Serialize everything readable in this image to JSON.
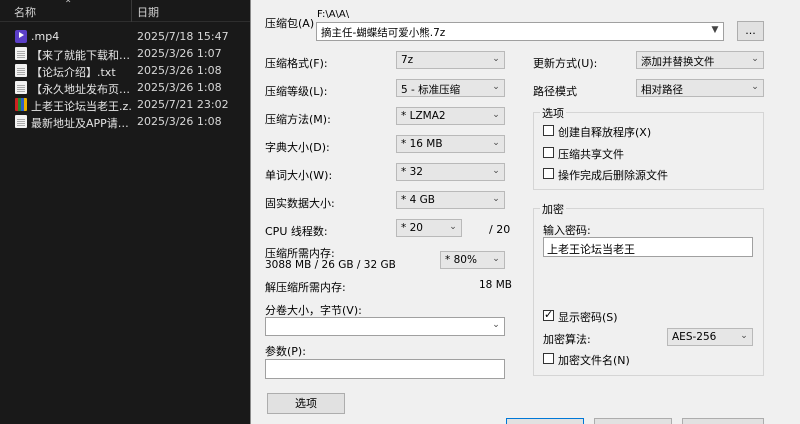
{
  "explorer": {
    "col_name": "名称",
    "col_date": "日期",
    "files": [
      {
        "name": ".mp4",
        "date": "2025/7/18 15:47",
        "icon": "video-file-icon"
      },
      {
        "name": "【来了就能下载和…",
        "date": "2025/3/26 1:07",
        "icon": "text-file-icon"
      },
      {
        "name": "【论坛介绍】.txt",
        "date": "2025/3/26 1:08",
        "icon": "text-file-icon"
      },
      {
        "name": "【永久地址发布页…",
        "date": "2025/3/26 1:08",
        "icon": "text-file-icon"
      },
      {
        "name": "上老王论坛当老王.z…",
        "date": "2025/7/21 23:02",
        "icon": "archive-file-icon"
      },
      {
        "name": "最新地址及APP请…",
        "date": "2025/3/26 1:08",
        "icon": "text-file-icon"
      }
    ]
  },
  "dialog": {
    "archive_label": "压缩包(A)",
    "archive_path": "F:\\A\\A\\",
    "archive_name": "摘主任-蝴蝶结可爱小熊.7z",
    "browse_label": "...",
    "format_label": "压缩格式(F):",
    "format_value": "7z",
    "level_label": "压缩等级(L):",
    "level_value": "5 - 标准压缩",
    "method_label": "压缩方法(M):",
    "method_value": "* LZMA2",
    "dict_label": "字典大小(D):",
    "dict_value": "* 16 MB",
    "word_label": "单词大小(W):",
    "word_value": "* 32",
    "solid_label": "固实数据大小:",
    "solid_value": "* 4 GB",
    "cpu_label": "CPU 线程数:",
    "cpu_value": "* 20",
    "cpu_max": "/ 20",
    "mem_label": "压缩所需内存:",
    "mem_detail": "3088 MB / 26 GB / 32 GB",
    "mem_value": "* 80%",
    "demem_label": "解压缩所需内存:",
    "demem_value": "18 MB",
    "split_label": "分卷大小，字节(V):",
    "split_value": "",
    "params_label": "参数(P):",
    "params_value": "",
    "options_button": "选项",
    "update_label": "更新方式(U):",
    "update_value": "添加并替换文件",
    "path_label": "路径模式",
    "path_value": "相对路径",
    "options_group": "选项",
    "sfx_label": "创建自释放程序(X)",
    "sfx_checked": false,
    "shared_label": "压缩共享文件",
    "shared_checked": false,
    "delete_label": "操作完成后删除源文件",
    "delete_checked": false,
    "encrypt_group": "加密",
    "password_label": "输入密码:",
    "password_value": "上老王论坛当老王",
    "show_pwd_label": "显示密码(S)",
    "show_pwd_checked": true,
    "enc_method_label": "加密算法:",
    "enc_method_value": "AES-256",
    "enc_names_label": "加密文件名(N)",
    "enc_names_checked": false
  }
}
